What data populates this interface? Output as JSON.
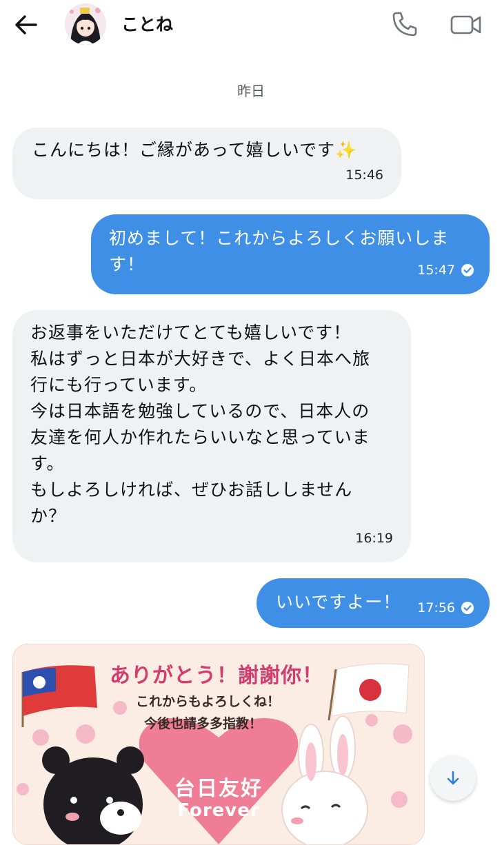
{
  "header": {
    "contact_name": "ことね"
  },
  "date_separator": "昨日",
  "messages": [
    {
      "direction": "incoming",
      "text": "こんにちは！ご縁があって嬉しいです✨",
      "time": "15:46"
    },
    {
      "direction": "outgoing",
      "text": "初めまして！これからよろしくお願いしま\nす！",
      "time": "15:47",
      "read": true
    },
    {
      "direction": "incoming",
      "text": "お返事をいただけてとても嬉しいです！\n私はずっと日本が大好きで、よく日本へ旅\n行にも行っています。\n今は日本語を勉強しているので、日本人の\n友達を何人か作れたらいいなと思っていま\nす。\nもしよろしければ、ぜひお話ししません\nか？",
      "time": "16:19"
    },
    {
      "direction": "outgoing",
      "text": "いいですよー！",
      "time": "17:56",
      "read": true
    }
  ],
  "image_card": {
    "title": "ありがとう！謝謝你！",
    "subtitle_1": "これからもよろしくね！",
    "subtitle_2": "今後也請多多指教！",
    "heart_text": "台日友好",
    "heart_subtext": "Forever"
  },
  "icons": {
    "back": "arrow-left-icon",
    "phone": "phone-icon",
    "video": "video-camera-icon",
    "read": "check-circle-icon",
    "scroll": "arrow-down-icon"
  },
  "colors": {
    "outgoing_bubble": "#3f8fe6",
    "incoming_bubble": "#eff1f3",
    "accent": "#2f7fd9"
  }
}
